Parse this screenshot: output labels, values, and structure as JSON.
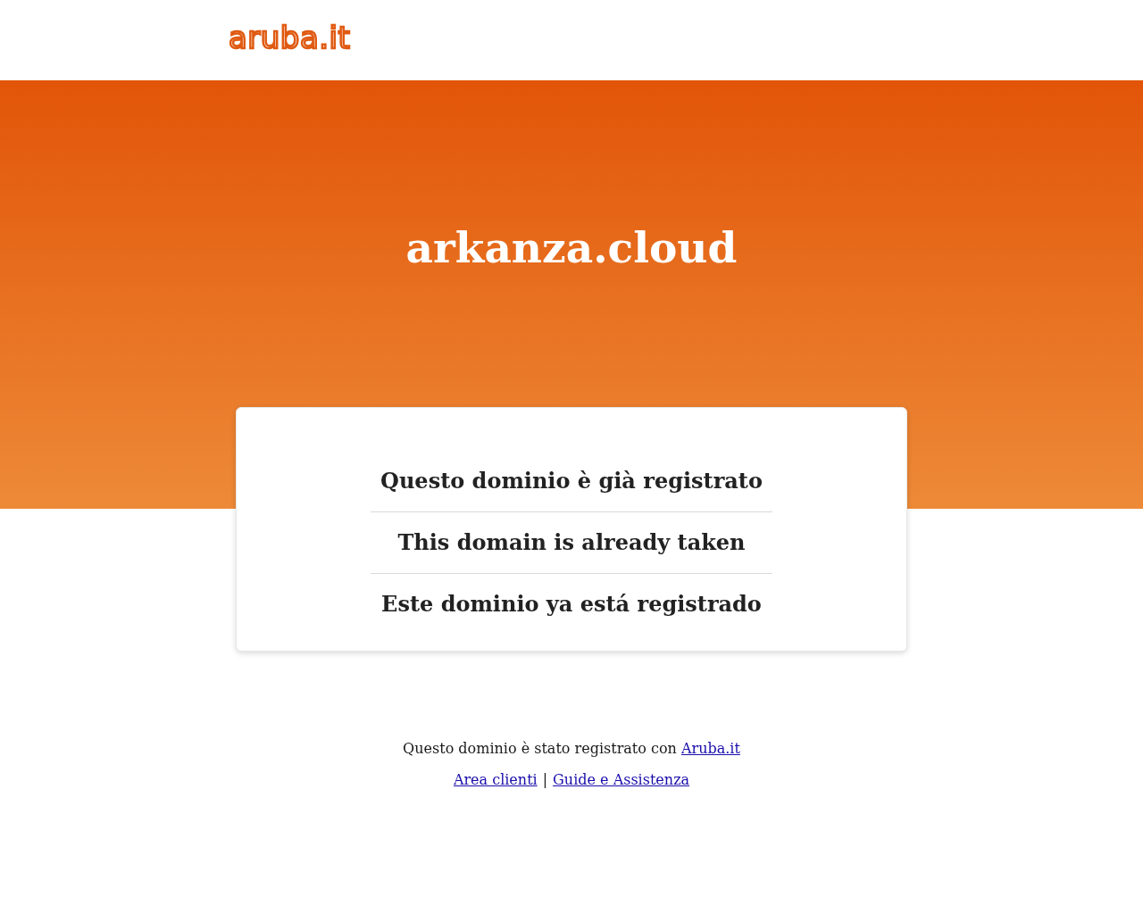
{
  "header": {
    "logo": "aruba.it"
  },
  "hero": {
    "title": "arkanza.cloud"
  },
  "messages": [
    "Questo dominio è già registrato",
    "This domain is already taken",
    "Este dominio ya está registrado"
  ],
  "footer": {
    "note": "Questo dominio è stato registrato con",
    "note_link": "Aruba.it",
    "links": [
      "Area clienti",
      "Guide e Assistenza"
    ],
    "separator": "|"
  }
}
